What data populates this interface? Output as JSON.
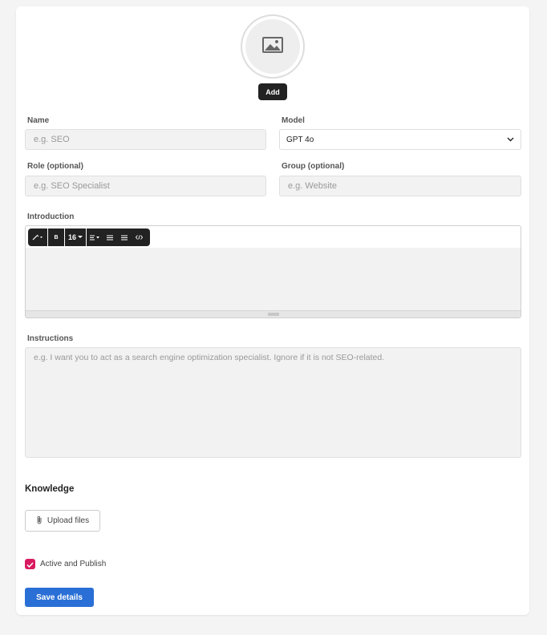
{
  "avatar": {
    "add_label": "Add",
    "icon": "image-icon"
  },
  "fields": {
    "name": {
      "label": "Name",
      "placeholder": "e.g. SEO"
    },
    "model": {
      "label": "Model",
      "value": "GPT 4o"
    },
    "role": {
      "label": "Role (optional)",
      "placeholder": "e.g. SEO Specialist"
    },
    "group": {
      "label": "Group (optional)",
      "placeholder": "e.g. Website"
    }
  },
  "introduction": {
    "label": "Introduction",
    "toolbar": {
      "font_size": "16",
      "bold": "B"
    }
  },
  "instructions": {
    "label": "Instructions",
    "placeholder": "e.g. I want you to act as a search engine optimization specialist. Ignore if it is not SEO-related."
  },
  "knowledge": {
    "title": "Knowledge",
    "upload_label": "Upload files"
  },
  "publish": {
    "label": "Active and Publish",
    "checked": true
  },
  "actions": {
    "save_label": "Save details"
  },
  "colors": {
    "primary": "#2a6fd6",
    "checkbox": "#d81b60",
    "dark": "#222222"
  }
}
